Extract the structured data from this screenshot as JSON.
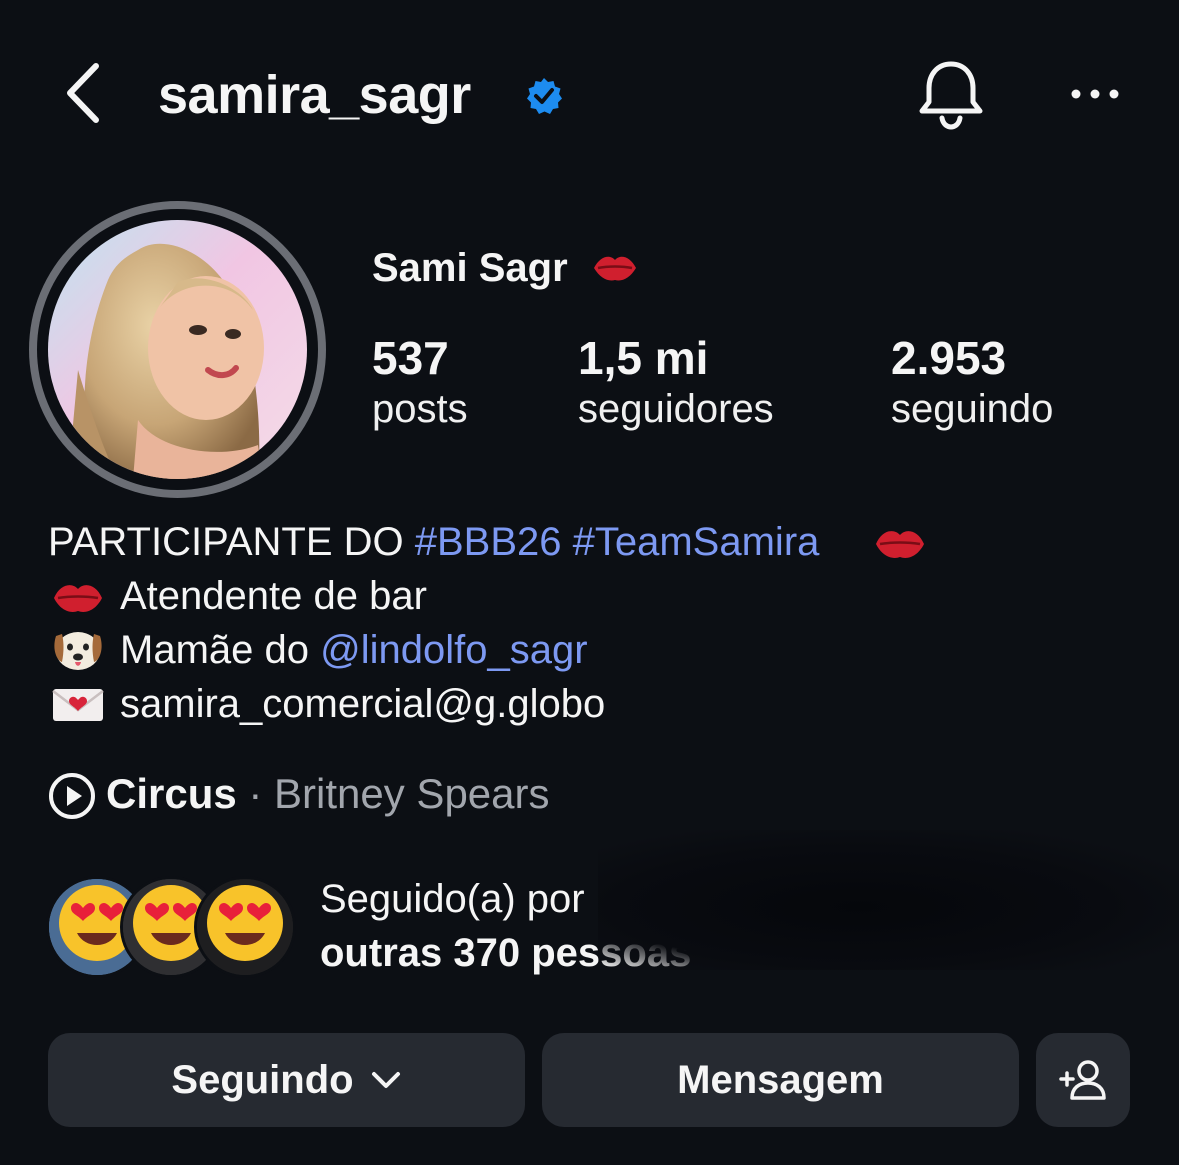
{
  "header": {
    "username": "samira_sagr",
    "verified": true,
    "icons": [
      "chevron-left-icon",
      "verified-badge-icon",
      "bell-icon",
      "more-horizontal-icon"
    ]
  },
  "profile": {
    "display_name": "Sami Sagr",
    "name_emoji": "kiss-mark-icon",
    "stats": {
      "posts": {
        "value": "537",
        "label": "posts"
      },
      "followers": {
        "value": "1,5 mi",
        "label": "seguidores"
      },
      "following": {
        "value": "2.953",
        "label": "seguindo"
      }
    }
  },
  "bio": {
    "line1": {
      "text": "PARTICIPANTE DO ",
      "hashtag1": "#BBB26",
      "space": " ",
      "hashtag2": "#TeamSamira"
    },
    "line2": {
      "text": "Atendente de bar"
    },
    "line3": {
      "text": "Mamãe do ",
      "mention": "@lindolfo_sagr"
    },
    "line4": {
      "text": "samira_comercial@g.globo"
    }
  },
  "music": {
    "title": "Circus",
    "separator": " · ",
    "artist": "Britney Spears"
  },
  "followed_by": {
    "line1": "Seguido(a) por",
    "line2": "outras 370 pessoas"
  },
  "actions": {
    "following_label": "Seguindo",
    "message_label": "Mensagem"
  },
  "colors": {
    "background": "#0c0f14",
    "link": "#7d99f2",
    "verified": "#1d8cf0",
    "button": "#262a31",
    "secondary_text": "#a2a6ad"
  }
}
